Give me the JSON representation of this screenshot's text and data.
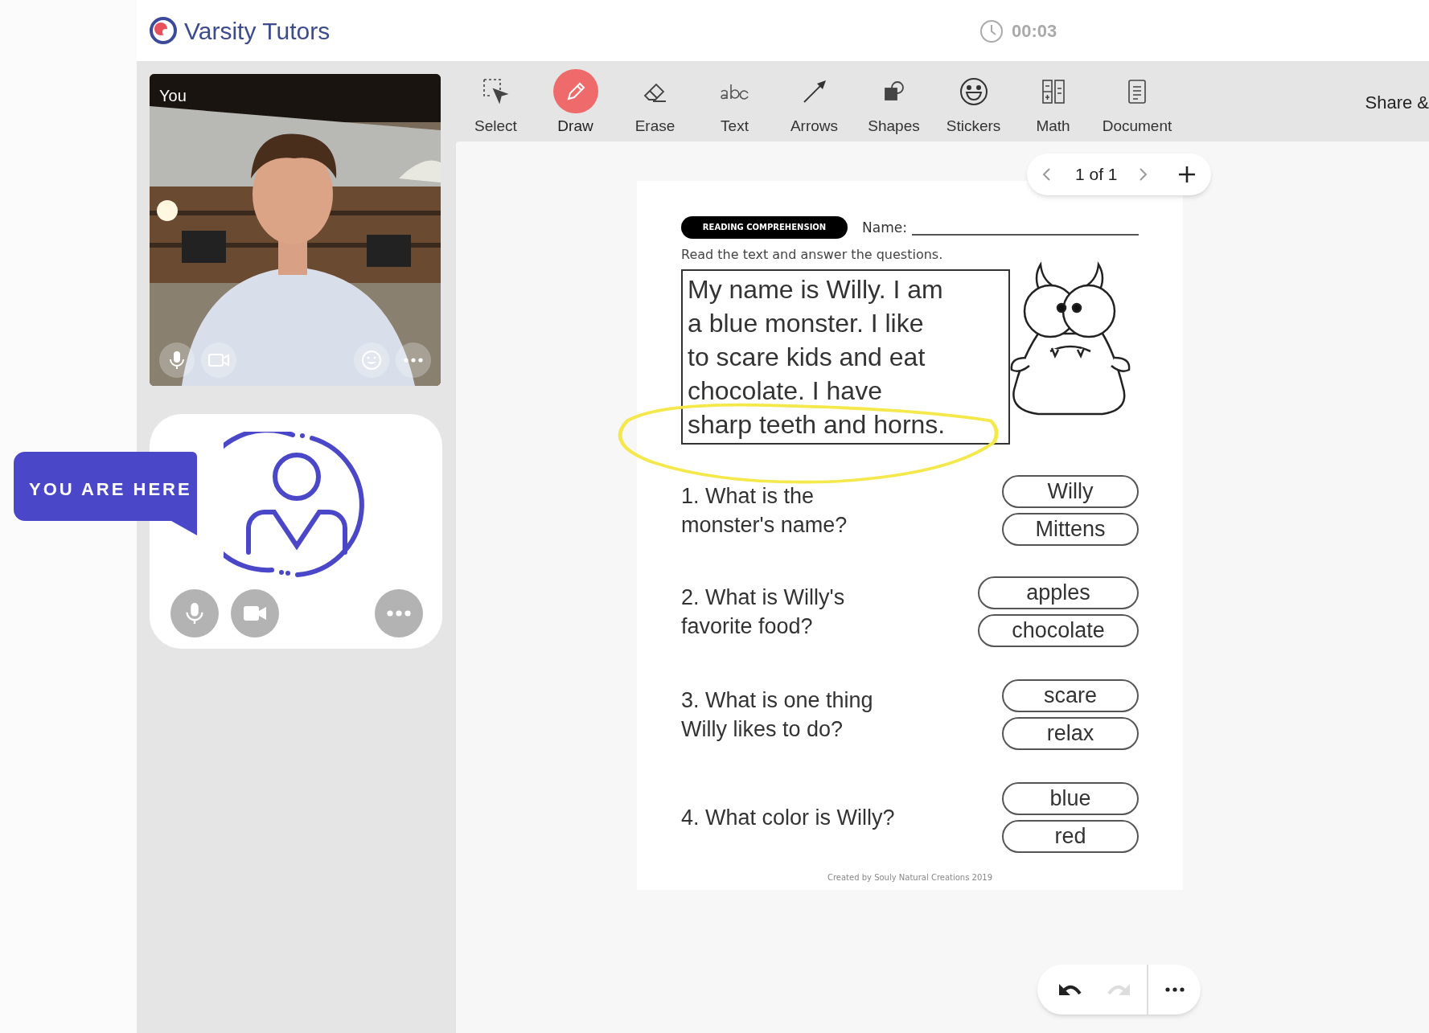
{
  "header": {
    "logo_text": "Varsity Tutors",
    "timer": "00:03"
  },
  "video": {
    "label": "You",
    "kind": "picture"
  },
  "callout": {
    "text": "YOU ARE HERE"
  },
  "toolbar": {
    "tools": [
      {
        "label": "Select",
        "selected": false
      },
      {
        "label": "Draw",
        "selected": true
      },
      {
        "label": "Erase",
        "selected": false
      },
      {
        "label": "Text",
        "selected": false
      },
      {
        "label": "Arrows",
        "selected": false
      },
      {
        "label": "Shapes",
        "selected": false
      },
      {
        "label": "Stickers",
        "selected": false
      },
      {
        "label": "Math",
        "selected": false
      },
      {
        "label": "Document",
        "selected": false
      }
    ],
    "share_label": "Share &"
  },
  "pager": {
    "text": "1 of 1"
  },
  "worksheet": {
    "tag": "READING COMPREHENSION",
    "name_label": "Name:",
    "instruction": "Read the text and answer the questions.",
    "passage_lines": [
      "My name is Willy. I am",
      "a blue monster. I like",
      "to scare kids and eat",
      "chocolate. I have",
      "sharp teeth and horns."
    ],
    "questions": [
      {
        "lines": [
          "1. What is the",
          "monster's name?"
        ],
        "options": [
          "Willy",
          "Mittens"
        ]
      },
      {
        "lines": [
          "2. What is Willy's",
          "favorite food?"
        ],
        "options": [
          "apples",
          "chocolate"
        ]
      },
      {
        "lines": [
          "3. What is one thing",
          "Willy likes to do?"
        ],
        "options": [
          "scare",
          "relax"
        ]
      },
      {
        "lines": [
          "4. What color is Willy?"
        ],
        "options": [
          "blue",
          "red"
        ]
      }
    ],
    "credit": "Created by Souly Natural Creations 2019"
  },
  "history": {
    "can_undo": true,
    "can_redo": false
  }
}
